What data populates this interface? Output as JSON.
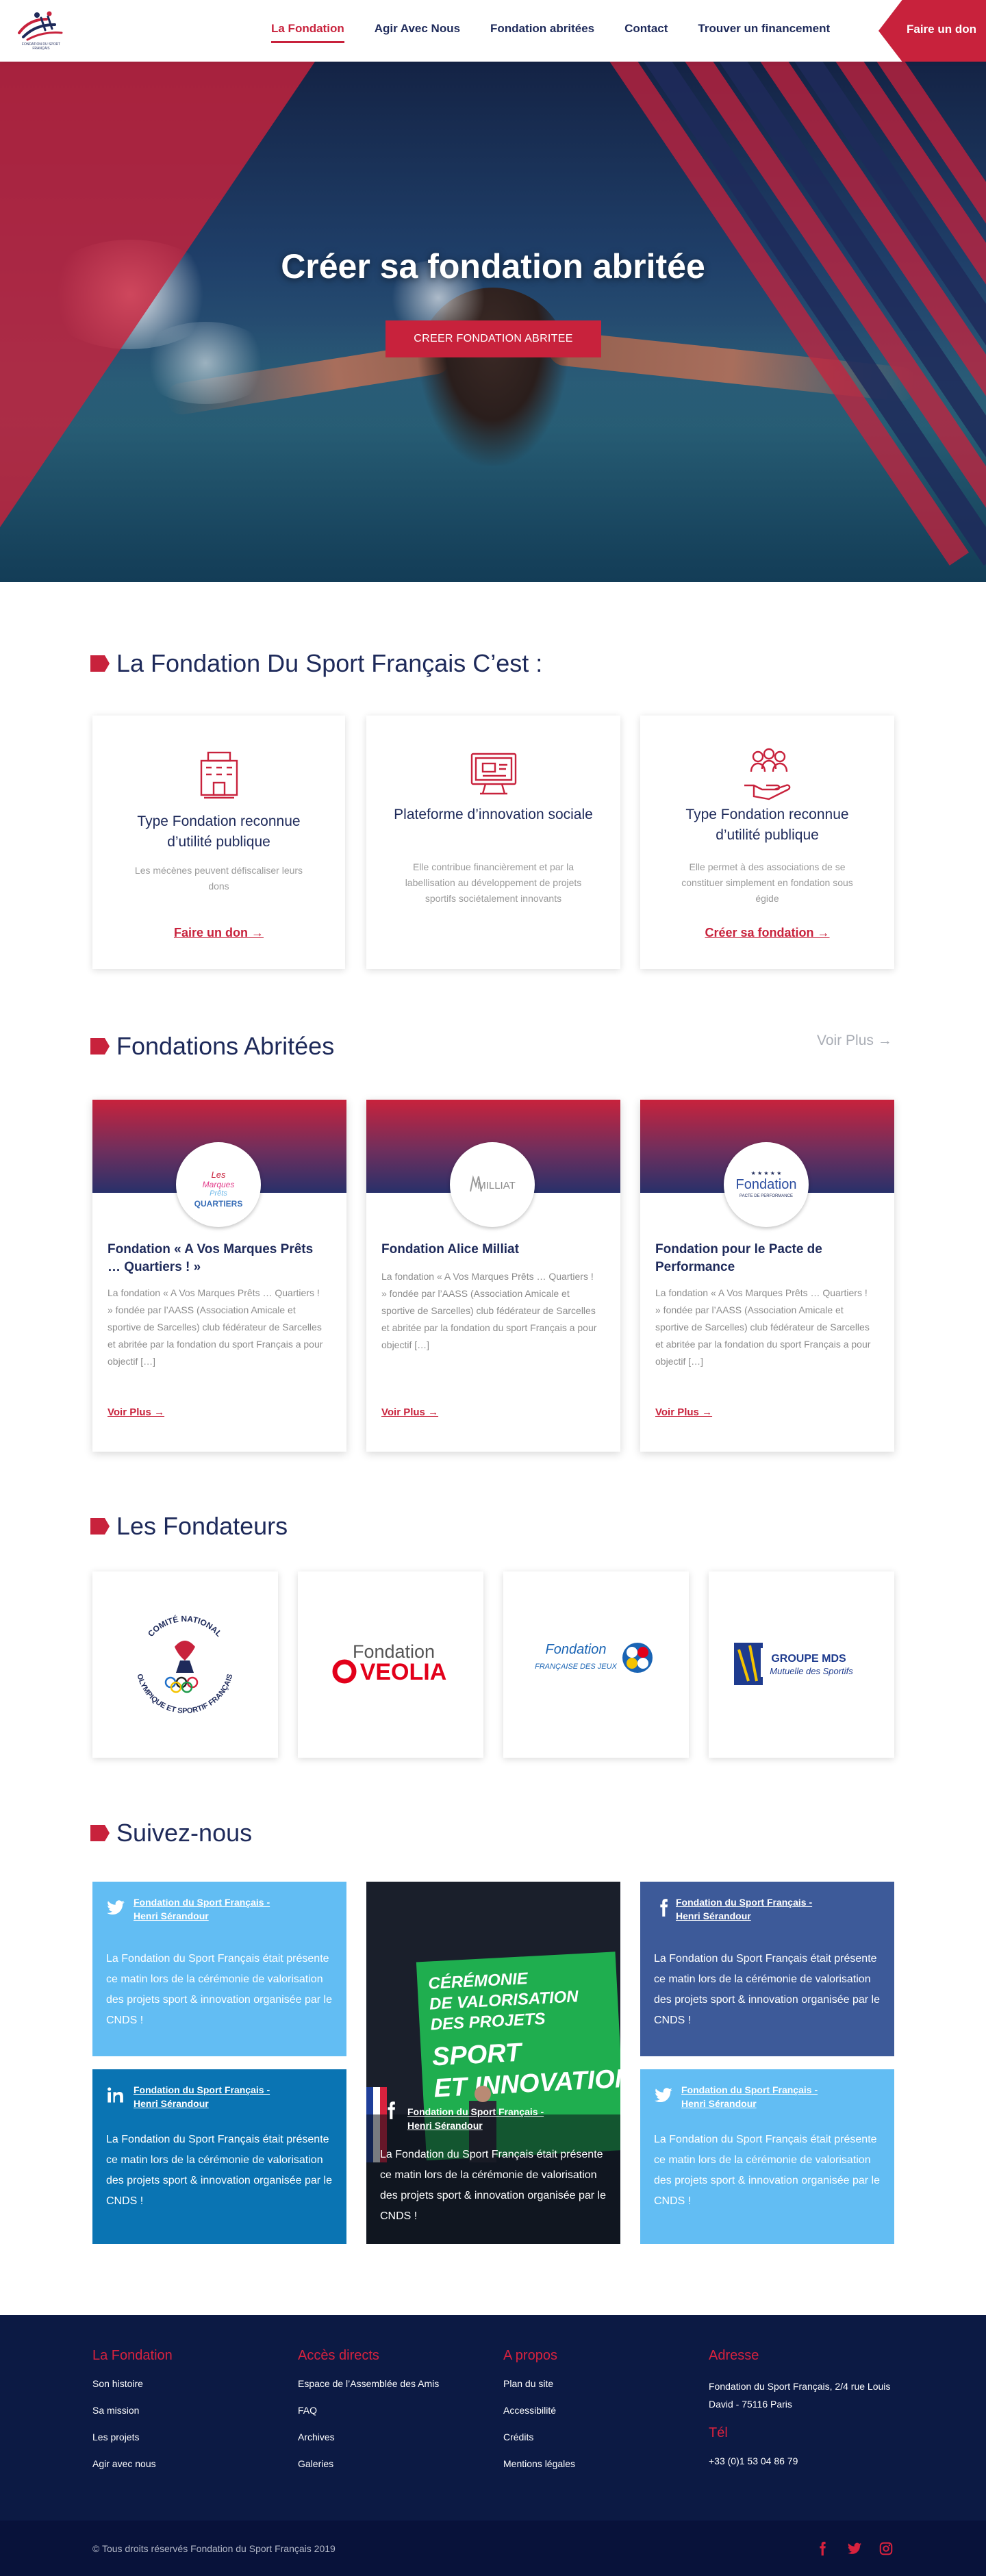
{
  "header": {
    "logo_text": "FONDATION DU SPORT FRANÇAIS",
    "nav": [
      "La Fondation",
      "Agir Avec Nous",
      "Fondation abritées",
      "Contact",
      "Trouver un financement"
    ],
    "donate": "Faire un don"
  },
  "hero": {
    "title": "Créer sa fondation abritée",
    "cta": "CREER FONDATION ABRITEE"
  },
  "intro": {
    "title": "La Fondation Du Sport Français C’est :",
    "cards": [
      {
        "icon": "building-icon",
        "title": "Type Fondation reconnue d’utilité publique",
        "desc": "Les mécènes peuvent défiscaliser leurs dons",
        "link": "Faire un don →"
      },
      {
        "icon": "computer-screen-icon",
        "title": "Plateforme d’innovation sociale",
        "desc": "Elle contribue financièrement et  par la labellisation au développement de projets sportifs sociétalement innovants",
        "link": ""
      },
      {
        "icon": "people-hand-icon",
        "title": "Type Fondation reconnue d’utilité publique",
        "desc": "Elle permet à des associations de se constituer simplement en fondation sous égide",
        "link": "Créer sa fondation →"
      }
    ]
  },
  "hosted": {
    "title": "Fondations Abritées",
    "more": "Voir Plus →",
    "cards": [
      {
        "logo": "Les Marques Prêts QUARTIERS",
        "name": "Fondation « A Vos Marques Prêts … Quartiers ! »",
        "desc": "La fondation « A Vos Marques Prêts … Quartiers ! » fondée par l’AASS (Association Amicale et sportive de Sarcelles) club fédérateur de Sarcelles et abritée par la fondation du sport Français a pour objectif […]",
        "link": "Voir Plus →"
      },
      {
        "logo": "MILLIAT",
        "name": "Fondation Alice Milliat",
        "desc": "La fondation « A Vos Marques Prêts … Quartiers ! » fondée par l’AASS (Association Amicale et sportive de Sarcelles) club fédérateur de Sarcelles et abritée par la fondation du sport Français a pour objectif […]",
        "link": "Voir Plus →"
      },
      {
        "logo": "Fondation PACTE DE PERFORMANCE",
        "name": "Fondation pour le Pacte de Performance",
        "desc": "La fondation « A Vos Marques Prêts … Quartiers ! » fondée par l’AASS (Association Amicale et sportive de Sarcelles) club fédérateur de Sarcelles et abritée par la fondation du sport Français a pour objectif […]",
        "link": "Voir Plus →"
      }
    ]
  },
  "founders": {
    "title": "Les Fondateurs",
    "logos": [
      {
        "top": "COMITÉ NATIONAL",
        "bottom": "OLYMPIQUE ET SPORTIF FRANÇAIS"
      },
      {
        "top": "Fondation",
        "bottom": "VEOLIA"
      },
      {
        "top": "Fondation",
        "bottom": "FRANÇAISE DES JEUX"
      },
      {
        "top": "GROUPE MDS",
        "bottom": "Mutuelle des Sportifs"
      }
    ]
  },
  "social": {
    "title": "Suivez-nous",
    "author": "Fondation du Sport Français - Henri Sérandour",
    "text": "La Fondation du Sport Français était présente ce matin lors de la cérémonie de valorisation des projets sport & innovation organisée par le CNDS !",
    "screen_lines": [
      "CÉRÉMONIE",
      "DE VALORISATION",
      "DES PROJETS",
      "SPORT",
      "ET INNOVATION"
    ],
    "colors": {
      "twitter": "#62bdf3",
      "facebook": "#3d5a99",
      "linkedin": "#0a74b3"
    }
  },
  "footer": {
    "cols": [
      {
        "title": "La Fondation",
        "links": [
          "Son histoire",
          "Sa mission",
          "Les projets",
          "Agir avec nous"
        ]
      },
      {
        "title": "Accès directs",
        "links": [
          "Espace de l’Assemblée des Amis",
          "FAQ",
          "Archives",
          "Galeries"
        ]
      },
      {
        "title": "A propos",
        "links": [
          "Plan du site",
          "Accessibilité",
          "Crédits",
          "Mentions légales"
        ]
      }
    ],
    "address_title": "Adresse",
    "address": "Fondation du Sport Français, 2/4 rue Louis David - 75116 Paris",
    "tel_title": "Tél",
    "tel": "+33 (0)1 53 04 86 79",
    "copyright": "© Tous droits réservés Fondation du Sport Français 2019"
  }
}
